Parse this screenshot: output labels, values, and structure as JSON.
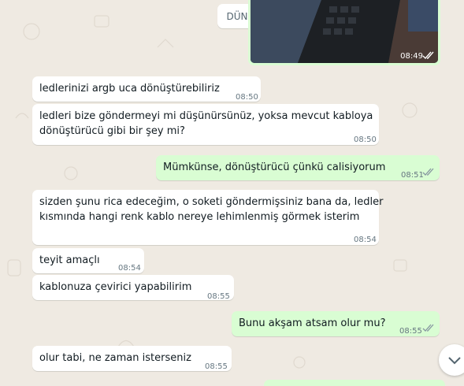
{
  "date_separator": "DÜN",
  "image_message": {
    "time": "08:49",
    "status": "read"
  },
  "messages": [
    {
      "dir": "in",
      "lines": [
        "ledlerinizi argb uca dönüştürebiliriz"
      ],
      "time": "08:50"
    },
    {
      "dir": "in",
      "lines": [
        "ledleri bize göndermeyi mi düşünürsünüz, yoksa mevcut kabloya",
        "dönüştürücü gibi bir şey mi?"
      ],
      "time": "08:50"
    },
    {
      "dir": "out",
      "lines": [
        "Mümkünse, dönüştürücü çünkü calisiyorum"
      ],
      "time": "08:51",
      "status": "delivered"
    },
    {
      "dir": "in",
      "lines": [
        "sizden şunu rica edeceğim, o soketi göndermişsiniz bana da, ledler",
        "kısmında hangi renk kablo nereye lehimlenmiş görmek isterim"
      ],
      "time": "08:54"
    },
    {
      "dir": "in",
      "lines": [
        "teyit amaçlı"
      ],
      "time": "08:54"
    },
    {
      "dir": "in",
      "lines": [
        "kablonuza çevirici yapabilirim"
      ],
      "time": "08:55"
    },
    {
      "dir": "out",
      "lines": [
        "Bunu akşam atsam olur mu?"
      ],
      "time": "08:55",
      "status": "delivered"
    },
    {
      "dir": "in",
      "lines": [
        "olur tabi, ne zaman isterseniz"
      ],
      "time": "08:55"
    }
  ],
  "colors": {
    "wallpaper": "#efeae2",
    "incoming_bubble": "#ffffff",
    "outgoing_bubble": "#d9fdd3",
    "meta_text": "#667781",
    "read_tick": "#53bdeb",
    "delivered_tick": "#8696a0"
  },
  "icons": {
    "scroll_down": "chevron-down-icon",
    "read_receipt": "double-check-icon"
  }
}
